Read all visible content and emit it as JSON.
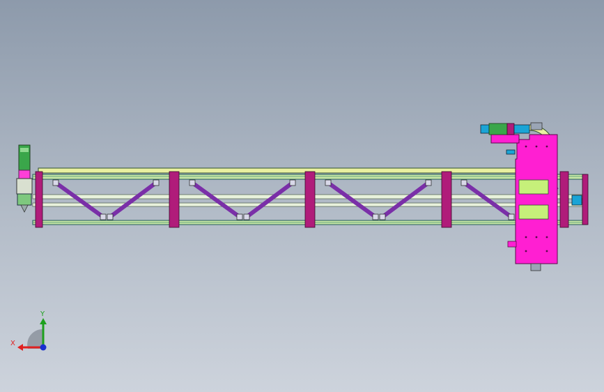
{
  "viewport": {
    "background_top": "#8d9aab",
    "background_bottom": "#cdd3dc"
  },
  "model": {
    "frame_color": "#b01c7a",
    "rail_color": "#c9e6a6",
    "rail_outline": "#1f5a5a",
    "brace_color": "#7a2fa8",
    "carriage_color": "#ff1fd2",
    "cable_chain_color": "#e9f0a0",
    "motor_color": "#1aa4d6",
    "bay_count": 4
  },
  "triad": {
    "x_label": "X",
    "y_label": "Y",
    "x_color": "#e02020",
    "y_color": "#1ea01e",
    "z_color": "#1a2fd0"
  }
}
